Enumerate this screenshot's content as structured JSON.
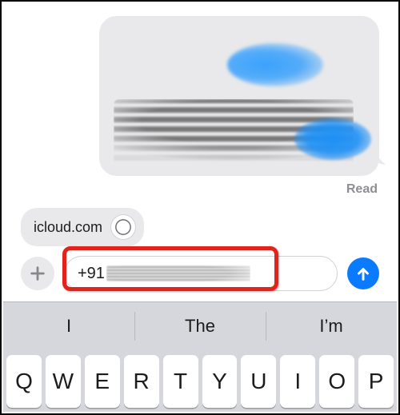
{
  "conversation": {
    "read_label": "Read"
  },
  "chip": {
    "label": "icloud.com",
    "icon": "safari-compass-icon"
  },
  "compose": {
    "add_icon": "plus-icon",
    "input_prefix": "+91",
    "send_icon": "arrow-up-icon"
  },
  "keyboard": {
    "suggestions": [
      "I",
      "The",
      "I’m"
    ],
    "row1": [
      "Q",
      "W",
      "E",
      "R",
      "T",
      "Y",
      "U",
      "I",
      "O",
      "P"
    ]
  },
  "colors": {
    "ios_blue": "#0a7aff",
    "bubble_gray": "#e9e9eb",
    "kb_bg": "#d5d7dc",
    "highlight_red": "#e0241b"
  }
}
